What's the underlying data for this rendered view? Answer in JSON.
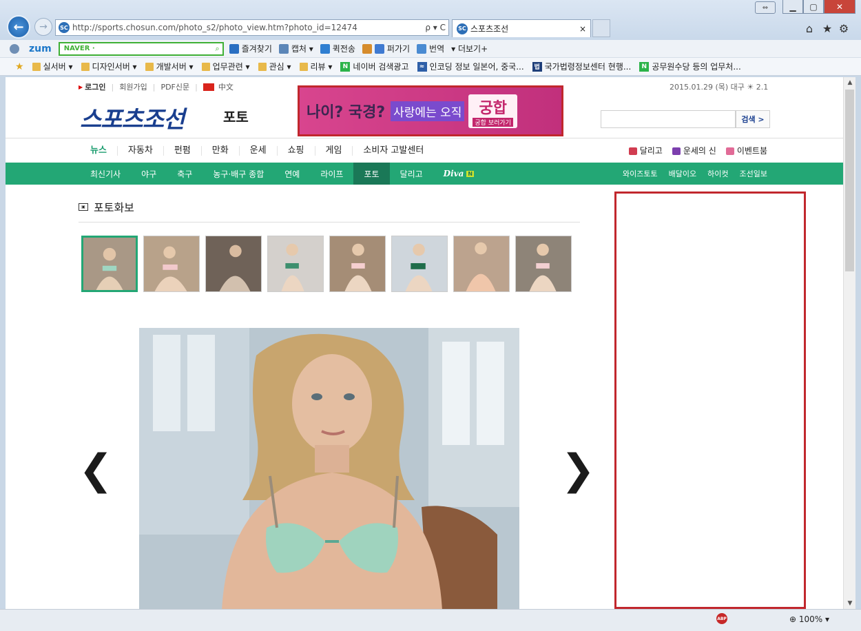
{
  "browser": {
    "address_url": "http://sports.chosun.com/photo_s2/photo_view.htm?photo_id=12474",
    "address_controls": "ρ ▾ C",
    "tab_title": "스포츠조선",
    "tab_close": "×",
    "favicon_text": "SC",
    "zoom_level": "100%",
    "adblock_label": "ABP"
  },
  "toolbar": {
    "zum_label": "zum",
    "naver_label": "NAVER ·",
    "items": [
      "즐겨찾기",
      "캡처 ▾",
      "퀵전송",
      "퍼가기",
      "번역",
      "▾ 더보기+"
    ]
  },
  "favorites": {
    "items": [
      {
        "label": "실서버 ▾",
        "kind": "folder"
      },
      {
        "label": "디자인서버 ▾",
        "kind": "folder"
      },
      {
        "label": "개발서버 ▾",
        "kind": "folder"
      },
      {
        "label": "업무관련 ▾",
        "kind": "folder"
      },
      {
        "label": "관심 ▾",
        "kind": "folder"
      },
      {
        "label": "리뷰 ▾",
        "kind": "folder"
      },
      {
        "label": "네이버 검색광고",
        "kind": "naver"
      },
      {
        "label": "인코딩 정보 일본어, 중국...",
        "kind": "site"
      },
      {
        "label": "국가법령정보센터  현행...",
        "kind": "site"
      },
      {
        "label": "공무원수당 등의 업무처...",
        "kind": "naver"
      }
    ]
  },
  "site": {
    "top": {
      "login": "로그인",
      "join": "회원가입",
      "pdf": "PDF신문",
      "chinese": "中文",
      "date_weather": "2015.01.29 (목) 대구 ☀ 2.1"
    },
    "logo_main": "스포츠조선",
    "logo_sub": "포토",
    "search_button": "검색 >",
    "banner": {
      "part1": "나이? 국경?",
      "part2": "사랑에는 오직",
      "part3": "궁합",
      "part4": "궁합 보러가기"
    },
    "gnb": [
      "뉴스",
      "자동차",
      "펀펌",
      "만화",
      "운세",
      "쇼핑",
      "게임",
      "소비자 고발센터"
    ],
    "gnb_right": [
      "달리고",
      "운세의 신",
      "이벤트붐"
    ],
    "lnb": [
      "최신기사",
      "야구",
      "축구",
      "농구·배구 종합",
      "연예",
      "라이프",
      "포토",
      "달리고",
      "Diva"
    ],
    "lnb_badge": "N",
    "lnb_right": [
      "와이즈토토",
      "배달이오",
      "하이컷",
      "조선일보"
    ],
    "page_title": "포토화보",
    "prev_arrow": "❮",
    "next_arrow": "❯"
  },
  "colors": {
    "brand_green": "#23a775",
    "brand_blue": "#1a3f8f",
    "highlight_red": "#c1272d"
  }
}
